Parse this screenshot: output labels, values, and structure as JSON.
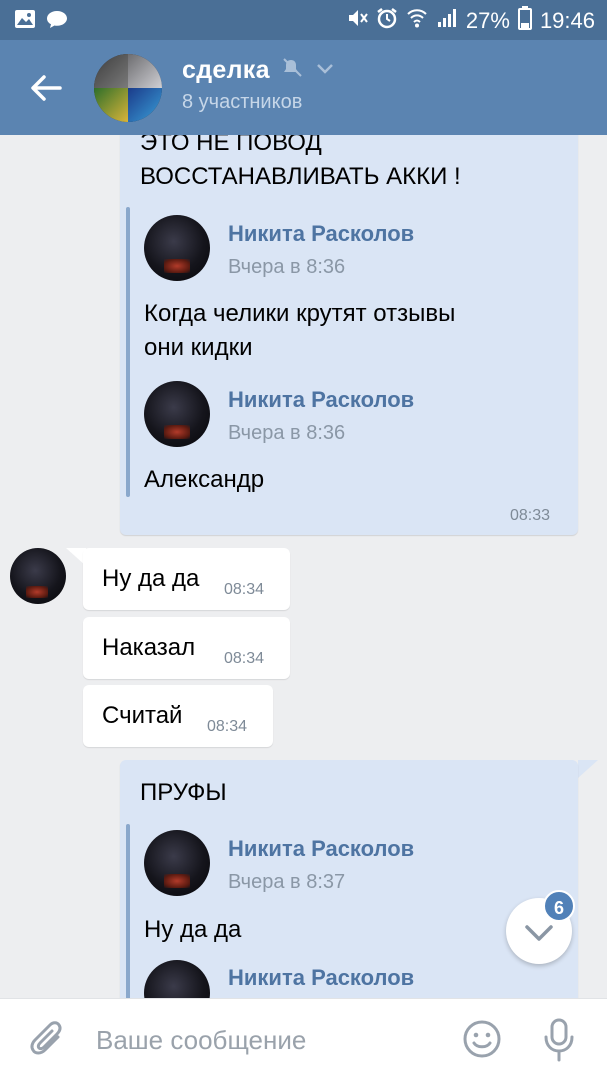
{
  "status_bar": {
    "battery": "27%",
    "time": "19:46"
  },
  "header": {
    "title": "сделка",
    "subtitle": "8 участников",
    "icons": [
      "back-arrow-icon",
      "muted-icon",
      "chevron-down-icon"
    ]
  },
  "messages": {
    "msg1": {
      "text_line1": "ЭТО НЕ ПОВОД",
      "text_line2": "ВОССТАНАВЛИВАТЬ АККИ !",
      "fwd1": {
        "name": "Никита Расколов",
        "date": "Вчера в 8:36",
        "text_line1": "Когда челики крутят отзывы",
        "text_line2": "они кидки"
      },
      "fwd2": {
        "name": "Никита Расколов",
        "date": "Вчера в 8:36",
        "text": "Александр"
      },
      "time": "08:33"
    },
    "in1": {
      "text": "Ну да да",
      "time": "08:34"
    },
    "in2": {
      "text": "Наказал",
      "time": "08:34"
    },
    "in3": {
      "text": "Считай",
      "time": "08:34"
    },
    "msg2": {
      "text": "ПРУФЫ",
      "fwd1": {
        "name": "Никита Расколов",
        "date": "Вчера в 8:37",
        "text": "Ну да да"
      },
      "fwd2": {
        "name": "Никита Расколов"
      }
    }
  },
  "scroll_fab": {
    "badge": "6"
  },
  "input": {
    "placeholder": "Ваше сообщение"
  },
  "colors": {
    "header": "#5b84b1",
    "status_bar": "#4a6f96",
    "bubble_out": "#dae5f5",
    "bubble_in": "#ffffff",
    "link": "#4e74a2",
    "background": "#edeef0"
  }
}
